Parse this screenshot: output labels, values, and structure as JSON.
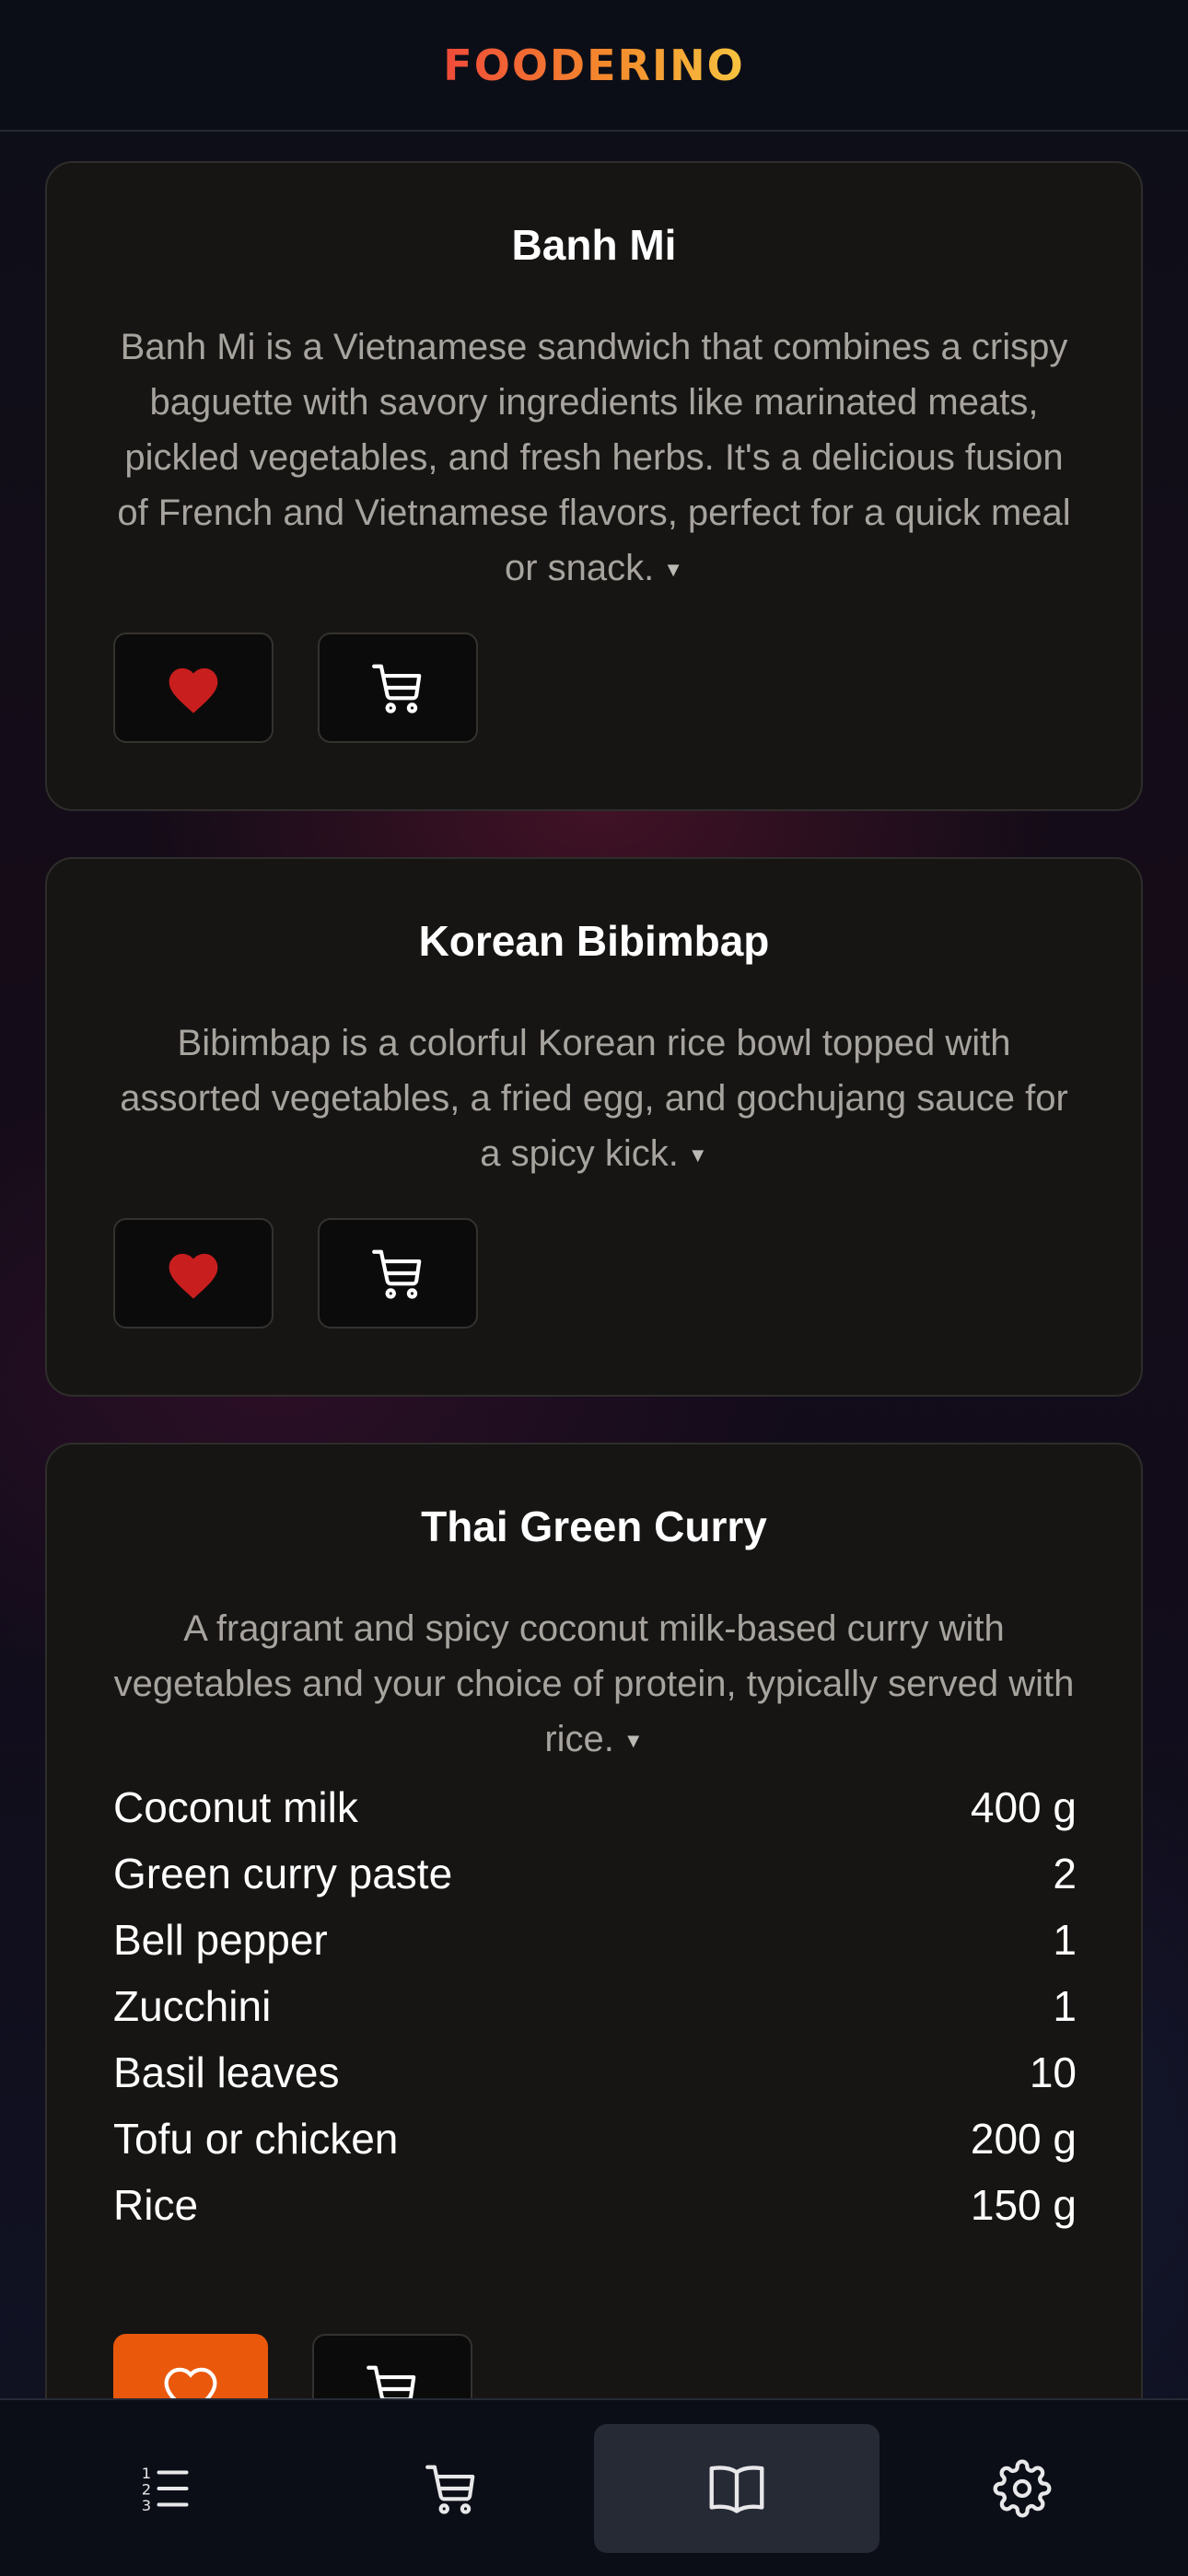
{
  "app": {
    "logo": "FOODERINO"
  },
  "recipes": [
    {
      "title": "Banh Mi",
      "description": "Banh Mi is a Vietnamese sandwich that combines a crispy baguette with savory ingredients like marinated meats, pickled vegetables, and fresh herbs. It's a delicious fusion of French and Vietnamese flavors, perfect for a quick meal or snack.",
      "favorite": true
    },
    {
      "title": "Korean Bibimbap",
      "description": "Bibimbap is a colorful Korean rice bowl topped with assorted vegetables, a fried egg, and gochujang sauce for a spicy kick.",
      "favorite": true
    },
    {
      "title": "Thai Green Curry",
      "description": "A fragrant and spicy coconut milk-based curry with vegetables and your choice of protein, typically served with rice.",
      "favorite": false,
      "ingredients": [
        {
          "name": "Coconut milk",
          "amount": "400 g"
        },
        {
          "name": "Green curry paste",
          "amount": "2"
        },
        {
          "name": "Bell pepper",
          "amount": "1"
        },
        {
          "name": "Zucchini",
          "amount": "1"
        },
        {
          "name": "Basil leaves",
          "amount": "10"
        },
        {
          "name": "Tofu or chicken",
          "amount": "200 g"
        },
        {
          "name": "Rice",
          "amount": "150 g"
        }
      ]
    }
  ],
  "nav": {
    "items": [
      {
        "icon": "list-icon",
        "active": false
      },
      {
        "icon": "cart-icon",
        "active": false
      },
      {
        "icon": "book-icon",
        "active": true
      },
      {
        "icon": "gear-icon",
        "active": false
      }
    ]
  },
  "colors": {
    "accent": "#ea580c",
    "heart": "#c81e1e",
    "card_bg": "#161514",
    "nav_bg": "#0c0e17"
  }
}
